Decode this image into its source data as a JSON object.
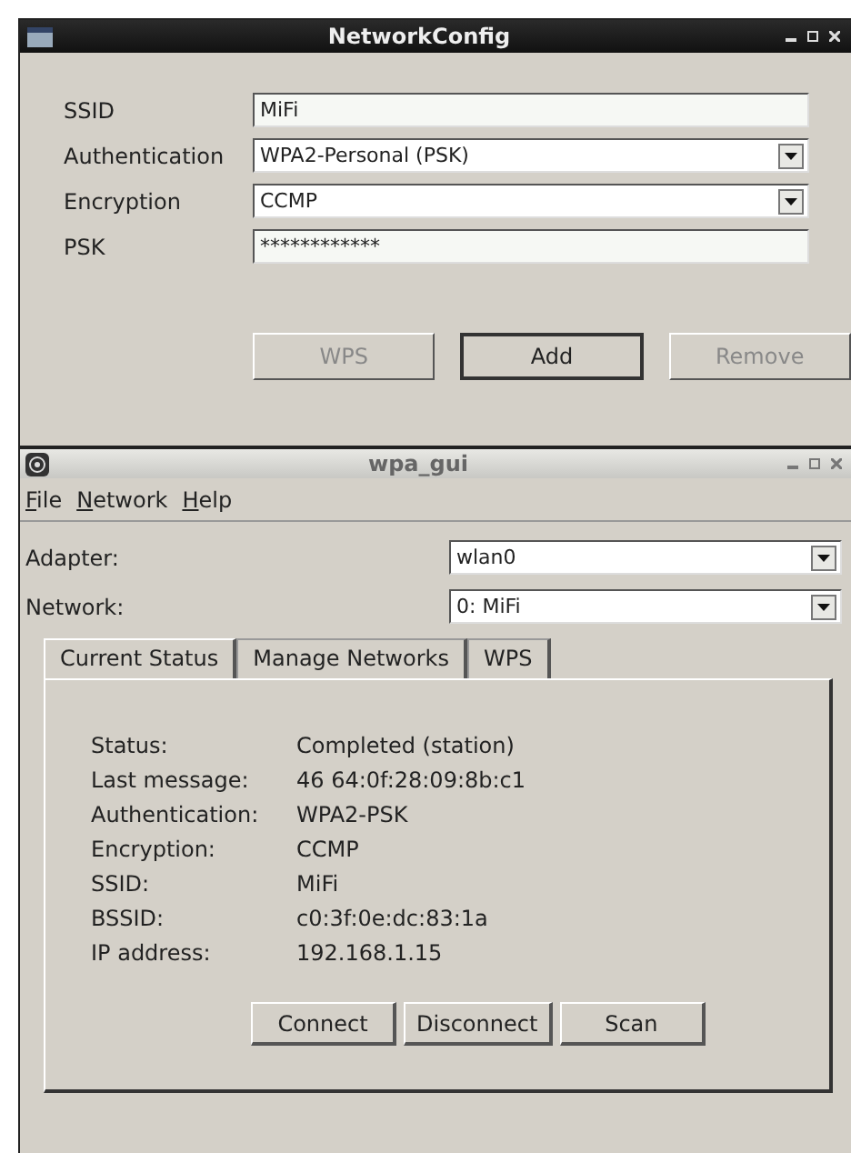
{
  "config_window": {
    "title": "NetworkConfig",
    "fields": [
      {
        "label": "SSID",
        "kind": "text",
        "value": "MiFi"
      },
      {
        "label": "Authentication",
        "kind": "combo",
        "value": "WPA2-Personal (PSK)"
      },
      {
        "label": "Encryption",
        "kind": "combo",
        "value": "CCMP"
      },
      {
        "label": "PSK",
        "kind": "text",
        "value": "************"
      }
    ],
    "buttons": [
      {
        "label": "WPS",
        "disabled": true,
        "default": false
      },
      {
        "label": "Add",
        "disabled": false,
        "default": true
      },
      {
        "label": "Remove",
        "disabled": true,
        "default": false
      }
    ]
  },
  "main_window": {
    "title": "wpa_gui",
    "menu": [
      "File",
      "Network",
      "Help"
    ],
    "selectors": [
      {
        "label": "Adapter:",
        "value": "wlan0"
      },
      {
        "label": "Network:",
        "value": "0: MiFi"
      }
    ],
    "tabs": [
      {
        "label": "Current Status",
        "selected": true
      },
      {
        "label": "Manage Networks",
        "selected": false
      },
      {
        "label": "WPS",
        "selected": false
      }
    ],
    "status": [
      {
        "label": "Status:",
        "value": "Completed (station)"
      },
      {
        "label": "Last message:",
        "value": "46 64:0f:28:09:8b:c1"
      },
      {
        "label": "Authentication:",
        "value": "WPA2-PSK"
      },
      {
        "label": "Encryption:",
        "value": "CCMP"
      },
      {
        "label": "SSID:",
        "value": "MiFi"
      },
      {
        "label": "BSSID:",
        "value": "c0:3f:0e:dc:83:1a"
      },
      {
        "label": "IP address:",
        "value": "192.168.1.15"
      }
    ],
    "buttons": [
      "Connect",
      "Disconnect",
      "Scan"
    ]
  }
}
